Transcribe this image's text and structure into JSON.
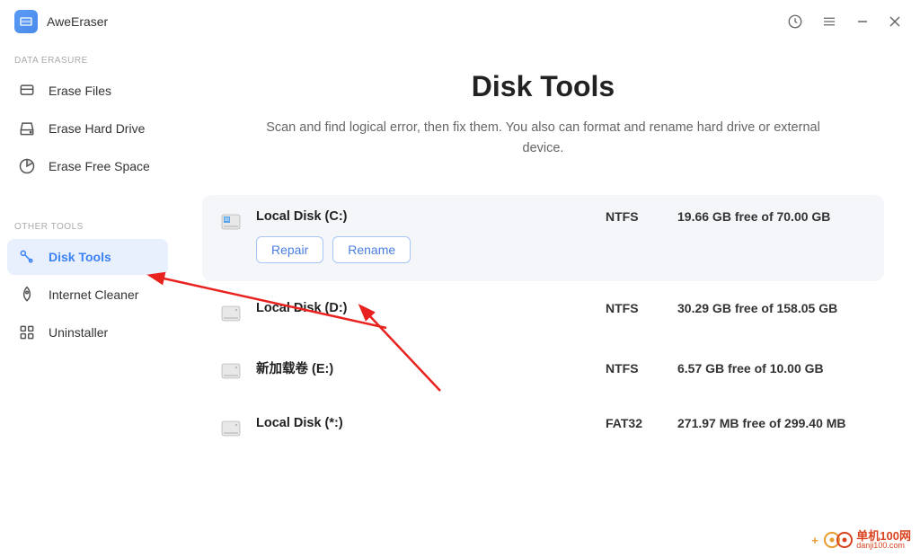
{
  "app": {
    "title": "AweEraser"
  },
  "sidebar": {
    "section1_label": "DATA ERASURE",
    "section2_label": "OTHER TOOLS",
    "items": [
      {
        "label": "Erase Files"
      },
      {
        "label": "Erase Hard Drive"
      },
      {
        "label": "Erase Free Space"
      },
      {
        "label": "Disk Tools"
      },
      {
        "label": "Internet Cleaner"
      },
      {
        "label": "Uninstaller"
      }
    ]
  },
  "main": {
    "title": "Disk Tools",
    "subtitle": "Scan and find logical error, then fix them. You also can format and rename hard drive or external device.",
    "repair_label": "Repair",
    "rename_label": "Rename"
  },
  "disks": [
    {
      "name": "Local Disk (C:)",
      "fs": "NTFS",
      "free": "19.66 GB free of 70.00 GB",
      "expanded": true
    },
    {
      "name": "Local Disk (D:)",
      "fs": "NTFS",
      "free": "30.29 GB free of 158.05 GB"
    },
    {
      "name": "新加载卷 (E:)",
      "fs": "NTFS",
      "free": "6.57 GB free of 10.00 GB"
    },
    {
      "name": "Local Disk (*:)",
      "fs": "FAT32",
      "free": "271.97 MB free of 299.40 MB"
    }
  ],
  "watermark": {
    "text1": "单机100网",
    "text2": "danji100.com"
  }
}
